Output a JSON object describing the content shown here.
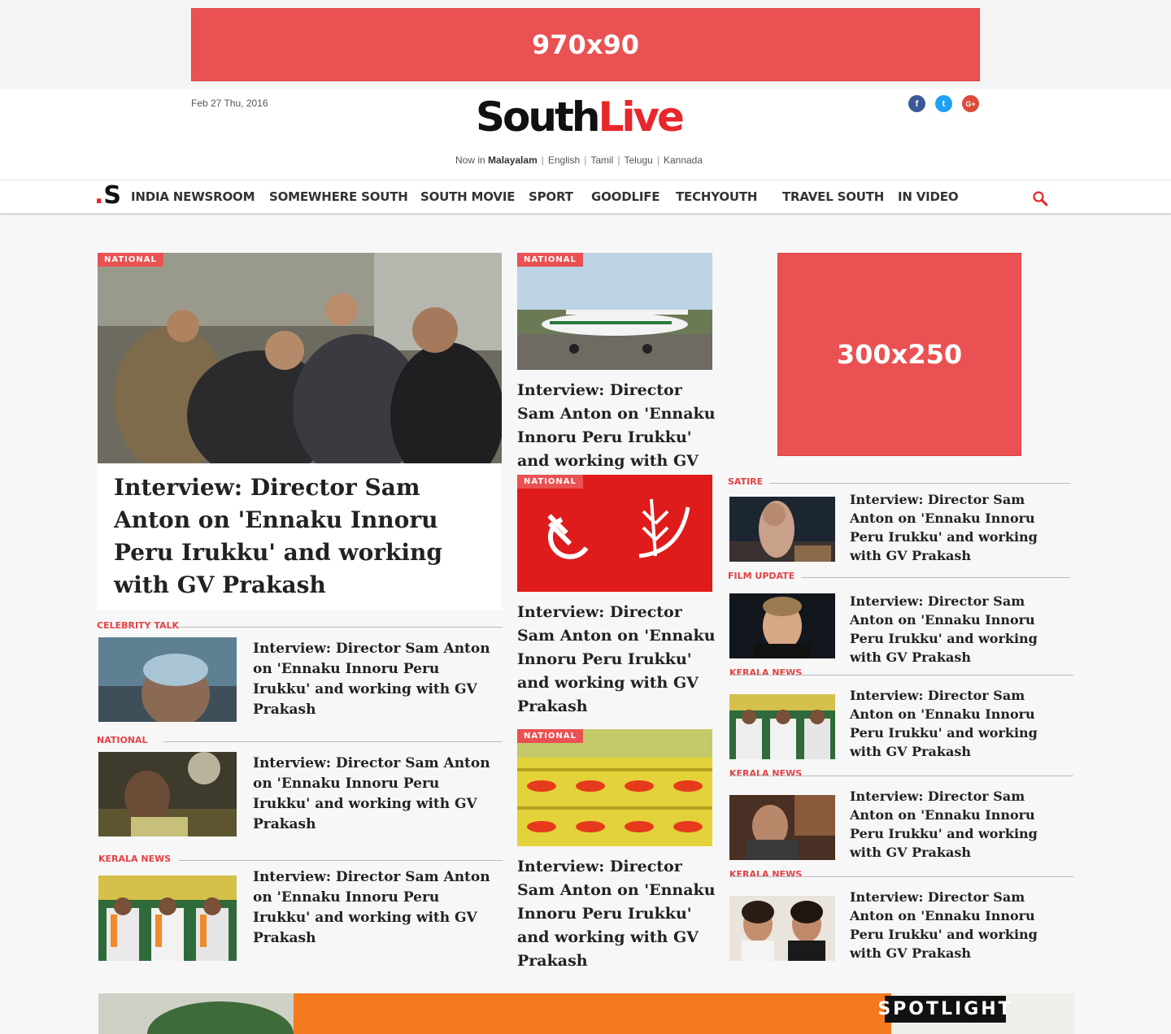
{
  "ads": {
    "top": "970x90",
    "side": "300x250"
  },
  "header": {
    "date": "Feb 27 Thu, 2016",
    "logo_part1": "South",
    "logo_part2": "Live",
    "langs_prefix": "Now in",
    "langs": [
      "Malayalam",
      "English",
      "Tamil",
      "Telugu",
      "Kannada"
    ],
    "social": {
      "facebook": "f",
      "twitter": "t",
      "googleplus": "G+"
    }
  },
  "nav": {
    "logo": "S",
    "items": [
      "INDIA NEWSROOM",
      "SOMEWHERE SOUTH",
      "SOUTH MOVIE",
      "SPORT",
      "GOODLIFE",
      "TECHYOUTH",
      "TRAVEL SOUTH",
      "IN VIDEO"
    ]
  },
  "feature": {
    "tag": "NATIONAL",
    "headline": "Interview: Director Sam Anton on 'Ennaku Innoru Peru Irukku' and working with GV Prakash"
  },
  "left_list": [
    {
      "category": "CELEBRITY TALK",
      "headline": "Interview: Director Sam Anton on 'Ennaku Innoru Peru Irukku' and working with GV Prakash"
    },
    {
      "category": "NATIONAL",
      "headline": "Interview: Director Sam Anton on 'Ennaku Innoru Peru Irukku' and working with GV Prakash"
    },
    {
      "category": "KERALA NEWS",
      "headline": "Interview: Director Sam Anton on 'Ennaku Innoru Peru Irukku' and working with GV Prakash"
    }
  ],
  "middle": [
    {
      "tag": "NATIONAL",
      "headline": "Interview: Director Sam Anton on 'Ennaku Innoru Peru Irukku' and working with GV Prakash"
    },
    {
      "tag": "NATIONAL",
      "headline": "Interview: Director Sam Anton on 'Ennaku Innoru Peru Irukku' and working with GV Prakash"
    },
    {
      "tag": "NATIONAL",
      "headline": "Interview: Director Sam Anton on 'Ennaku Innoru Peru Irukku' and working with GV Prakash"
    }
  ],
  "right_list": [
    {
      "category": "SATIRE",
      "headline": "Interview: Director Sam Anton on 'Ennaku Innoru Peru Irukku' and working with GV Prakash"
    },
    {
      "category": "FILM UPDATE",
      "headline": "Interview: Director Sam Anton on 'Ennaku Innoru Peru Irukku' and working with GV Prakash"
    },
    {
      "category": "KERALA NEWS",
      "headline": "Interview: Director Sam Anton on 'Ennaku Innoru Peru Irukku' and working with GV Prakash"
    },
    {
      "category": "KERALA NEWS",
      "headline": "Interview: Director Sam Anton on 'Ennaku Innoru Peru Irukku' and working with GV Prakash"
    },
    {
      "category": "KERALA NEWS",
      "headline": "Interview: Director Sam Anton on 'Ennaku Innoru Peru Irukku' and working with GV Prakash"
    }
  ],
  "spotlight": {
    "label": "SPOTLIGHT"
  },
  "colors": {
    "accent": "#ea5153",
    "brand_red": "#e8262b",
    "category": "#e34245"
  }
}
